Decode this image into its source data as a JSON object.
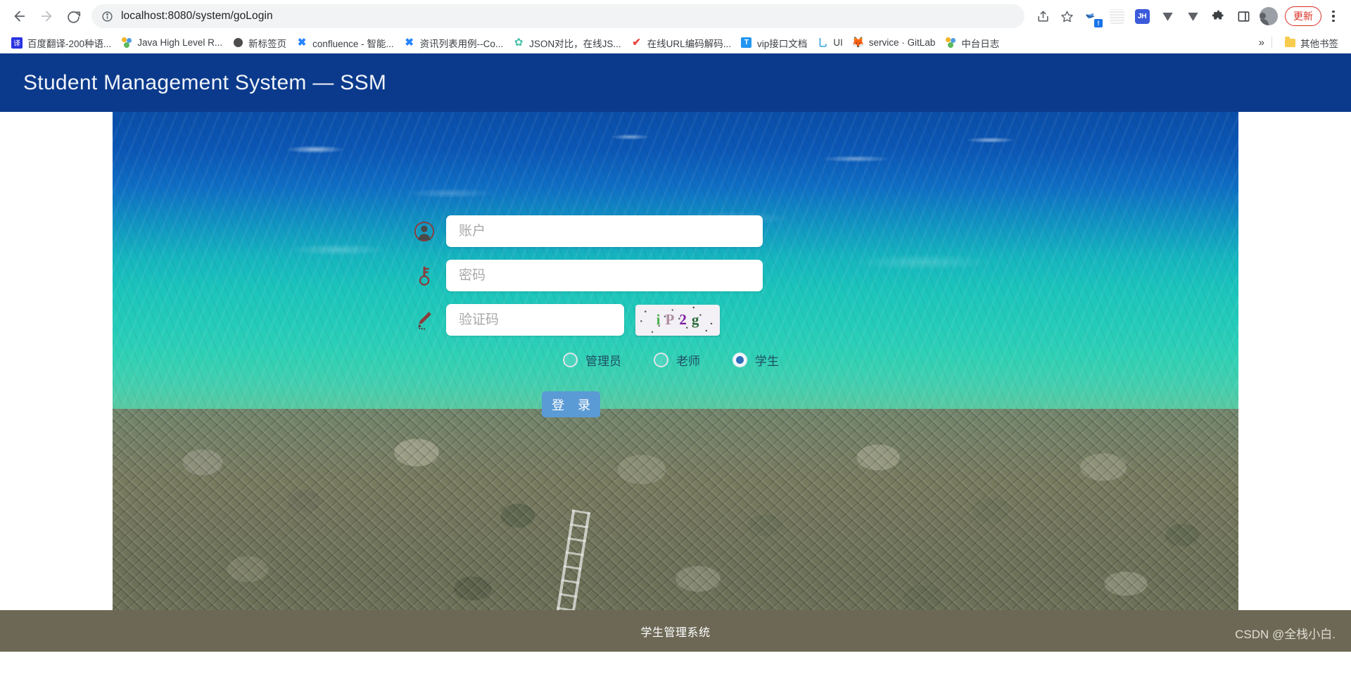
{
  "browser": {
    "back_label": "Back",
    "forward_label": "Forward",
    "reload_label": "Reload",
    "site_info_label": "Site information",
    "url_scheme": "localhost:8080",
    "url_path": "/system/goLogin",
    "url_full": "localhost:8080/system/goLogin",
    "share_label": "Share",
    "bookmark_star_label": "Bookmark this tab",
    "update_label": "更新",
    "menu_label": "Customize and control",
    "profile_label": "Profile",
    "extensions_label": "Extensions",
    "sidepanel_label": "Side panel",
    "ext_jh_label": "JH",
    "ext_items": [
      {
        "name": "bird-extension-icon",
        "label": ""
      },
      {
        "name": "qr-extension-icon",
        "label": ""
      },
      {
        "name": "jh-extension-icon",
        "label": "JH"
      },
      {
        "name": "v-extension-icon-1",
        "label": ""
      },
      {
        "name": "v-extension-icon-2",
        "label": ""
      }
    ]
  },
  "bookmarks": {
    "items": [
      {
        "label": "百度翻译-200种语...",
        "icon": "baidu-translate-icon"
      },
      {
        "label": "Java High Level R...",
        "icon": "people-icon"
      },
      {
        "label": "新标签页",
        "icon": "dot-icon"
      },
      {
        "label": "confluence - 智能...",
        "icon": "confluence-icon"
      },
      {
        "label": "资讯列表用例--Co...",
        "icon": "confluence-icon"
      },
      {
        "label": "JSON对比，在线JS...",
        "icon": "gear-icon"
      },
      {
        "label": "在线URL编码解码...",
        "icon": "check-icon"
      },
      {
        "label": "vip接口文档",
        "icon": "teambition-icon"
      },
      {
        "label": "UI",
        "icon": "ui-icon"
      },
      {
        "label": "service · GitLab",
        "icon": "gitlab-icon"
      },
      {
        "label": "中台日志",
        "icon": "people-icon"
      }
    ],
    "overflow_label": "»",
    "other_bookmarks_label": "其他书签"
  },
  "app": {
    "title": "Student Management System — SSM",
    "header_color": "#0b3a8c"
  },
  "login": {
    "account": {
      "placeholder": "账户",
      "value": "",
      "icon": "user-circle-icon"
    },
    "password": {
      "placeholder": "密码",
      "value": "",
      "icon": "key-icon"
    },
    "captcha": {
      "placeholder": "验证码",
      "value": "",
      "icon": "pencil-icon",
      "image_text": "iP2g",
      "image_chars": [
        {
          "char": "i",
          "color": "#4caf50"
        },
        {
          "char": "P",
          "color": "#b08ca0"
        },
        {
          "char": "2",
          "color": "#7b1fa2"
        },
        {
          "char": "g",
          "color": "#2e6b3a"
        }
      ]
    },
    "roles": [
      {
        "label": "管理员",
        "checked": false
      },
      {
        "label": "老师",
        "checked": false
      },
      {
        "label": "学生",
        "checked": true
      }
    ],
    "submit_label": "登 录",
    "submit_color": "#5b9bd5",
    "radio_checked_color": "#2d6fb8"
  },
  "footer": {
    "text": "学生管理系统",
    "background_color": "#6c6855",
    "watermark": "CSDN @全栈小白."
  }
}
